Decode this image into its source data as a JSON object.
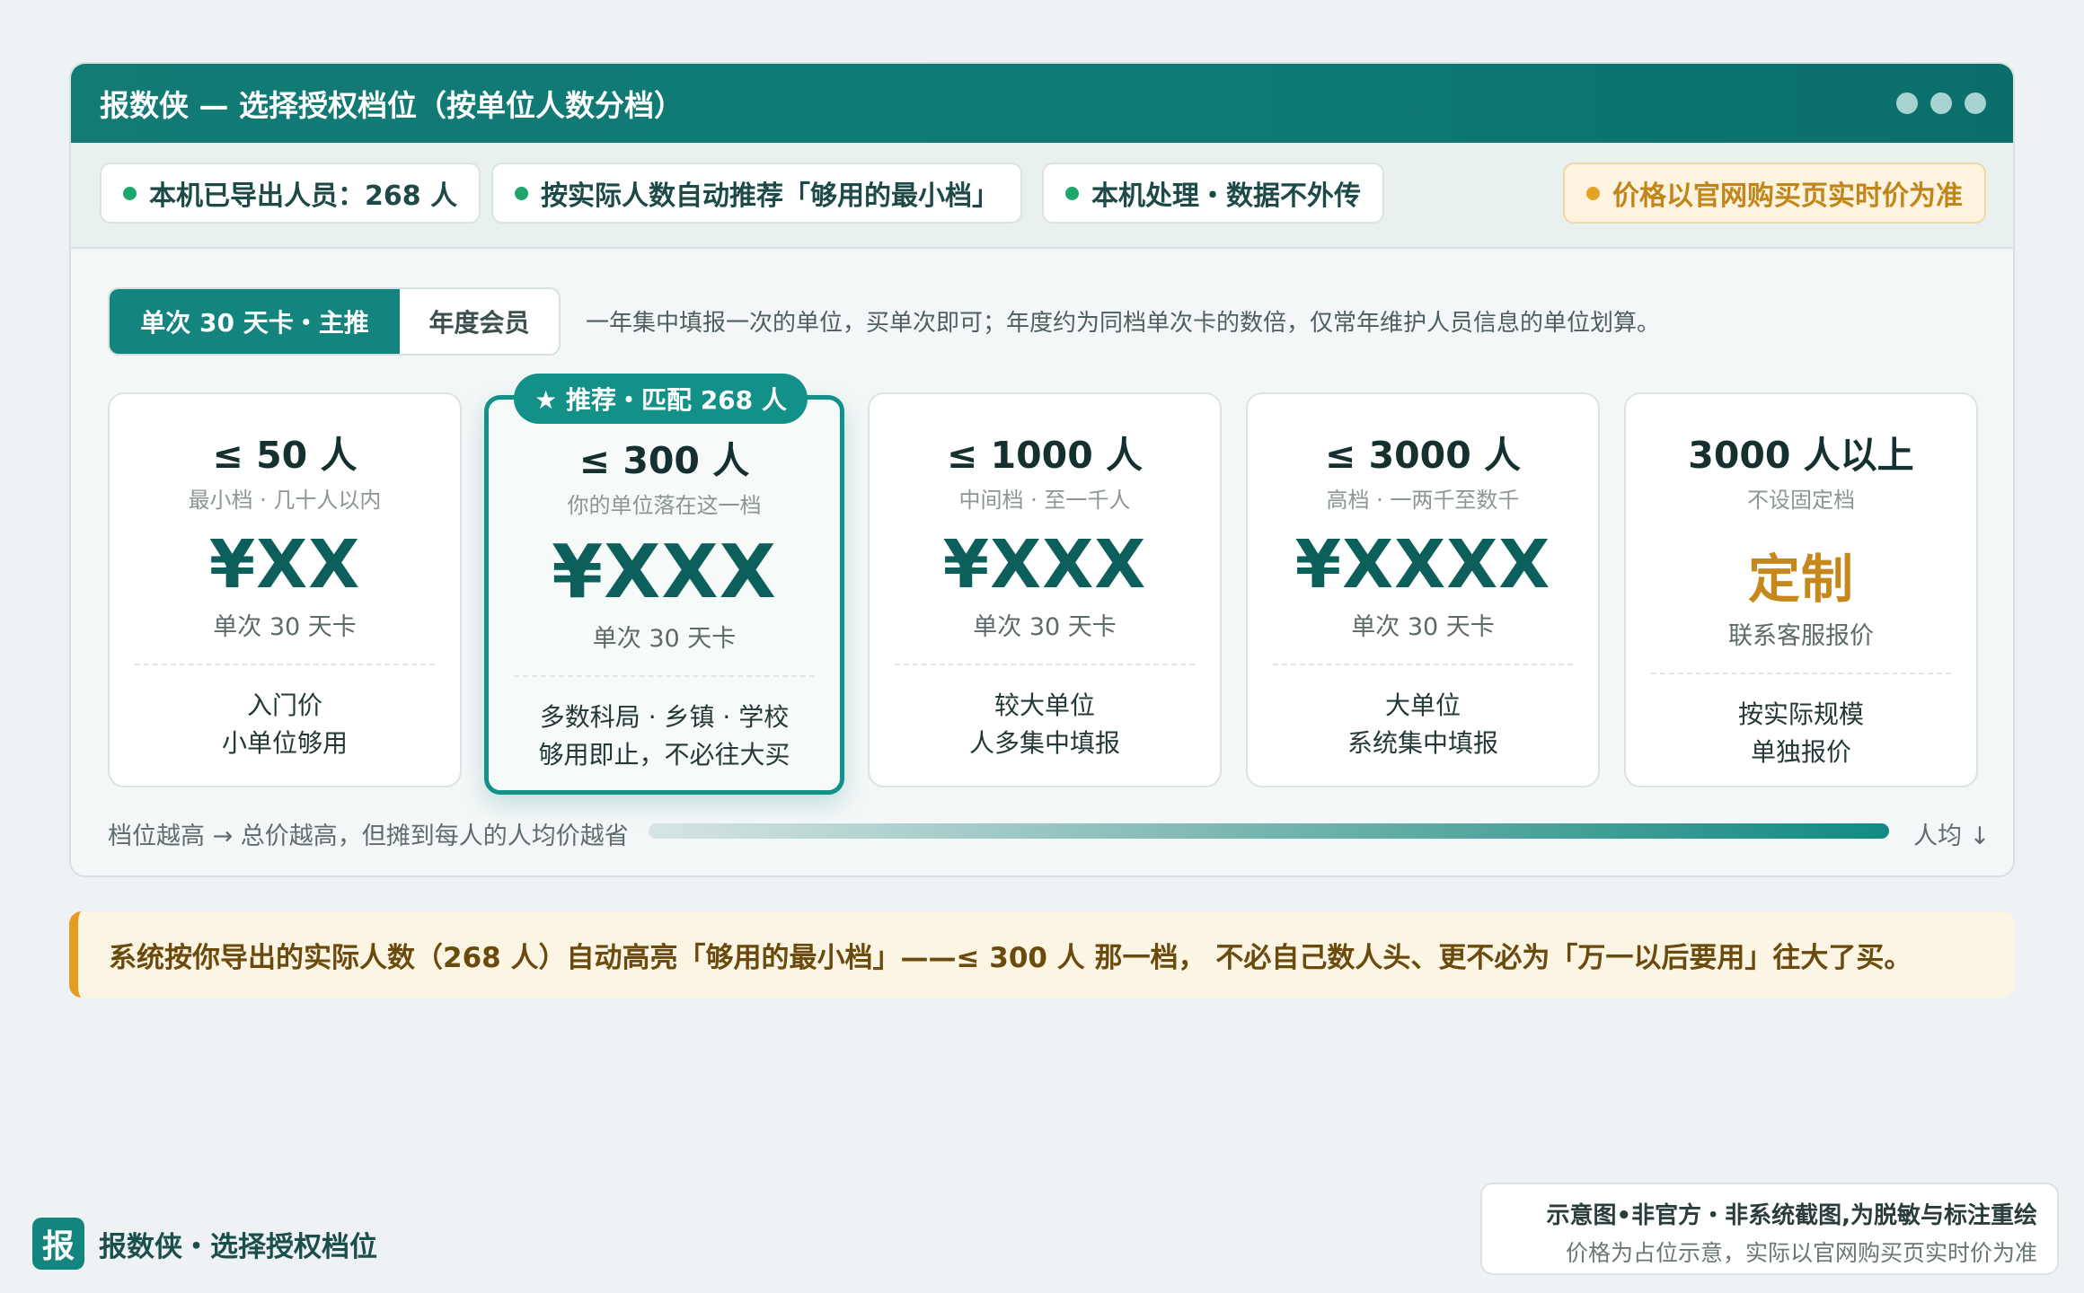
{
  "window": {
    "title": "报数侠 — 选择授权档位（按单位人数分档）"
  },
  "pills": [
    {
      "text": "本机已导出人员：268 人"
    },
    {
      "text": "按实际人数自动推荐「够用的最小档」"
    },
    {
      "text": "本机处理・数据不外传"
    },
    {
      "text": "价格以官网购买页实时价为准"
    }
  ],
  "tabs": {
    "active": "单次 30 天卡・主推",
    "inactive": "年度会员",
    "description": "一年集中填报一次的单位，买单次即可；年度约为同档单次卡的数倍，仅常年维护人员信息的单位划算。"
  },
  "cards": [
    {
      "tier": "≤ 50 人",
      "sub": "最小档 · 几十人以内",
      "price": "¥XX",
      "unit": "单次 30 天卡",
      "desc1": "入门价",
      "desc2": "小单位够用"
    },
    {
      "badge": "★ 推荐・匹配 268 人",
      "tier": "≤ 300 人",
      "sub": "你的单位落在这一档",
      "price": "¥XXX",
      "unit": "单次 30 天卡",
      "desc1": "多数科局 · 乡镇 · 学校",
      "desc2": "够用即止，不必往大买"
    },
    {
      "tier": "≤ 1000 人",
      "sub": "中间档 · 至一千人",
      "price": "¥XXX",
      "unit": "单次 30 天卡",
      "desc1": "较大单位",
      "desc2": "人多集中填报"
    },
    {
      "tier": "≤ 3000 人",
      "sub": "高档 · 一两千至数千",
      "price": "¥XXXX",
      "unit": "单次 30 天卡",
      "desc1": "大单位",
      "desc2": "系统集中填报"
    },
    {
      "tier": "3000 人以上",
      "sub": "不设固定档",
      "price": "定制",
      "unit": "联系客服报价",
      "desc1": "按实际规模",
      "desc2": "单独报价"
    }
  ],
  "gradient": {
    "label": "档位越高 → 总价越高，但摊到每人的人均价越省",
    "end": "人均 ↓"
  },
  "notice": "系统按你导出的实际人数（268 人）自动高亮「够用的最小档」——≤ 300 人 那一档， 不必自己数人头、更不必为「万一以后要用」往大了买。",
  "footer": {
    "logo": "报",
    "brand": "报数侠・选择授权档位",
    "disclaimer1": "示意图•非官方・非系统截图,为脱敏与标注重绘",
    "disclaimer2": "价格为占位示意，实际以官网购买页实时价为准"
  },
  "colors": {
    "accent": "#13857e",
    "warning": "#e59c22",
    "custom_price": "#c6871d"
  }
}
